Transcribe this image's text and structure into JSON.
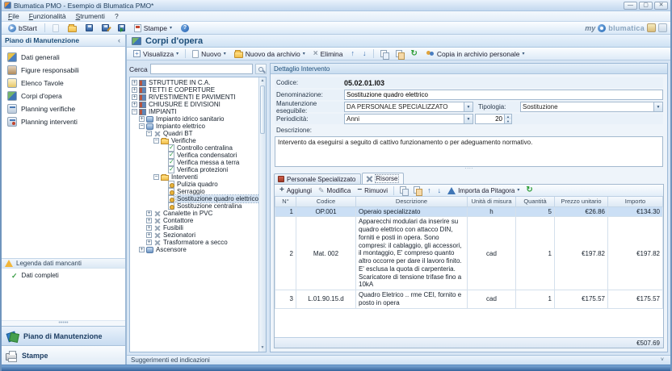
{
  "window": {
    "title": "Blumatica PMO - Esempio di Blumatica PMO*",
    "menu": [
      "File",
      "Funzionalità",
      "Strumenti",
      "?"
    ]
  },
  "toolbar": {
    "bstart_label": "bStart",
    "stampe_label": "Stampe",
    "brand_my": "my",
    "brand_name": "blumatica"
  },
  "sidebar": {
    "header": "Piano di Manutenzione",
    "items": [
      {
        "icon": "general",
        "label": "Dati generali"
      },
      {
        "icon": "figures",
        "label": "Figure responsabili"
      },
      {
        "icon": "tavole",
        "label": "Elenco Tavole"
      },
      {
        "icon": "corpi",
        "label": "Corpi d'opera"
      },
      {
        "icon": "planver",
        "label": "Planning verifiche"
      },
      {
        "icon": "planint",
        "label": "Planning interventi"
      }
    ],
    "legend": {
      "header": "Legenda dati mancanti",
      "item": "Dati completi"
    },
    "sections": [
      {
        "label": "Piano di Manutenzione",
        "active": true,
        "icon": "fan"
      },
      {
        "label": "Stampe",
        "active": false,
        "icon": "printer"
      }
    ]
  },
  "main": {
    "title": "Corpi d'opera",
    "toolbar": {
      "visualizza": "Visualizza",
      "nuovo": "Nuovo",
      "nuovo_da_archivio": "Nuovo da archivio",
      "elimina": "Elimina",
      "copia_archivio": "Copia in archivio personale"
    },
    "search_label": "Cerca",
    "tree": {
      "items": [
        {
          "depth": 0,
          "toggle": "+",
          "icon": "cat",
          "label": "STRUTTURE IN C.A."
        },
        {
          "depth": 0,
          "toggle": "+",
          "icon": "cat",
          "label": "TETTI E COPERTURE"
        },
        {
          "depth": 0,
          "toggle": "+",
          "icon": "cat",
          "label": "RIVESTIMENTI E PAVIMENTI"
        },
        {
          "depth": 0,
          "toggle": "+",
          "icon": "cat",
          "label": "CHIUSURE E DIVISIONI"
        },
        {
          "depth": 0,
          "toggle": "-",
          "icon": "cat",
          "label": "IMPIANTI"
        },
        {
          "depth": 1,
          "toggle": "+",
          "icon": "sys",
          "label": "Impianto idrico sanitario"
        },
        {
          "depth": 1,
          "toggle": "-",
          "icon": "sys",
          "label": "Impianto elettrico"
        },
        {
          "depth": 2,
          "toggle": "-",
          "icon": "tools",
          "label": "Quadri BT"
        },
        {
          "depth": 3,
          "toggle": "-",
          "icon": "folder",
          "label": "Verifiche"
        },
        {
          "depth": 4,
          "toggle": "",
          "icon": "check",
          "label": "Controllo centralina"
        },
        {
          "depth": 4,
          "toggle": "",
          "icon": "check",
          "label": "Verifica condensatori"
        },
        {
          "depth": 4,
          "toggle": "",
          "icon": "check",
          "label": "Verifica messa a terra"
        },
        {
          "depth": 4,
          "toggle": "",
          "icon": "check",
          "label": "Verifica protezioni"
        },
        {
          "depth": 3,
          "toggle": "-",
          "icon": "folder",
          "label": "Interventi"
        },
        {
          "depth": 4,
          "toggle": "",
          "icon": "gear",
          "label": "Pulizia quadro"
        },
        {
          "depth": 4,
          "toggle": "",
          "icon": "gear",
          "label": "Serraggio"
        },
        {
          "depth": 4,
          "toggle": "",
          "icon": "gear",
          "label": "Sostituzione quadro elettrico",
          "selected": true
        },
        {
          "depth": 4,
          "toggle": "",
          "icon": "gear",
          "label": "Sostituzione centralina"
        },
        {
          "depth": 2,
          "toggle": "+",
          "icon": "tools",
          "label": "Canalette in PVC"
        },
        {
          "depth": 2,
          "toggle": "+",
          "icon": "tools",
          "label": "Contattore"
        },
        {
          "depth": 2,
          "toggle": "+",
          "icon": "tools",
          "label": "Fusibili"
        },
        {
          "depth": 2,
          "toggle": "+",
          "icon": "tools",
          "label": "Sezionatori"
        },
        {
          "depth": 2,
          "toggle": "+",
          "icon": "tools",
          "label": "Trasformatore a secco"
        },
        {
          "depth": 1,
          "toggle": "+",
          "icon": "sys",
          "label": "Ascensore"
        }
      ]
    }
  },
  "detail": {
    "header": "Dettaglio Intervento",
    "fields": {
      "codice_label": "Codice:",
      "codice": "05.02.01.I03",
      "denominazione_label": "Denominazione:",
      "denominazione": "Sostituzione quadro elettrico",
      "manutenzione_label": "Manutenzione eseguibile:",
      "manutenzione": "DA PERSONALE SPECIALIZZATO",
      "tipologia_label": "Tipologia:",
      "tipologia": "Sostituzione",
      "periodicita_label": "Periodicità:",
      "periodicita": "Anni",
      "periodicita_value": "20",
      "descrizione_label": "Descrizione:",
      "descrizione": "Intervento da eseguirsi a seguito di cattivo funzionamento o per adeguamento normativo."
    },
    "tabs": [
      {
        "label": "Personale Specializzato",
        "active": false,
        "icon": "person"
      },
      {
        "label": "Risorse",
        "active": true,
        "icon": "tools"
      }
    ],
    "grid_toolbar": {
      "aggiungi": "Aggiungi",
      "modifica": "Modifica",
      "rimuovi": "Rimuovi",
      "importa": "Importa da Pitagora"
    },
    "table": {
      "columns": [
        "N°",
        "Codice",
        "Descrizione",
        "Unità di misura",
        "Quantità",
        "Prezzo unitario",
        "Importo"
      ],
      "rows": [
        {
          "n": "1",
          "codice": "OP.001",
          "descrizione": "Operaio specializzato",
          "um": "h",
          "qta": "5",
          "prezzo": "€26.86",
          "importo": "€134.30",
          "selected": true
        },
        {
          "n": "2",
          "codice": "Mat. 002",
          "descrizione": "Apparecchi modulari da inserire su quadro elettrico con attacco DIN, forniti e posti in opera. Sono compresi: il cablaggio, gli accessori, il montaggio, E' compreso quanto altro occorre per dare il lavoro finito. E' esclusa la quota di carpenteria. Scaricatore di tensione trifase fino a 10kA",
          "um": "cad",
          "qta": "1",
          "prezzo": "€197.82",
          "importo": "€197.82",
          "selected": false
        },
        {
          "n": "3",
          "codice": "L.01.90.15.d",
          "descrizione": "Quadro Eletrico .. rme CEI, fornito e posto in opera",
          "um": "cad",
          "qta": "1",
          "prezzo": "€175.57",
          "importo": "€175.57",
          "selected": false
        }
      ],
      "total": "€507.69"
    }
  },
  "statusbar": {
    "text": "Suggerimenti ed indicazioni"
  }
}
